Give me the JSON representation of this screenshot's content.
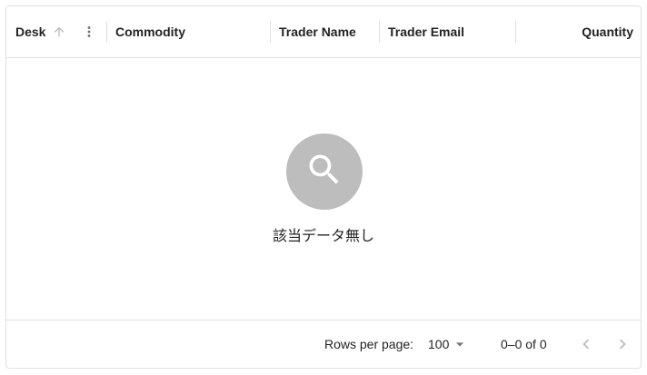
{
  "columns": [
    {
      "label": "Desk",
      "sortable": true,
      "sort_direction": "asc"
    },
    {
      "label": "Commodity"
    },
    {
      "label": "Trader Name"
    },
    {
      "label": "Trader Email"
    },
    {
      "label": "Quantity"
    }
  ],
  "no_rows": {
    "icon": "search-icon",
    "message": "該当データ無し"
  },
  "footer": {
    "rows_per_page_label": "Rows per page:",
    "rows_per_page_value": "100",
    "displayed_rows": "0–0 of 0",
    "prev_icon": "chevron-left-icon",
    "next_icon": "chevron-right-icon"
  },
  "colors": {
    "border": "#e0e0e0",
    "no_rows_circle": "#bdbdbd",
    "icon_disabled": "#bdbdbd",
    "icon_default": "#757575"
  }
}
